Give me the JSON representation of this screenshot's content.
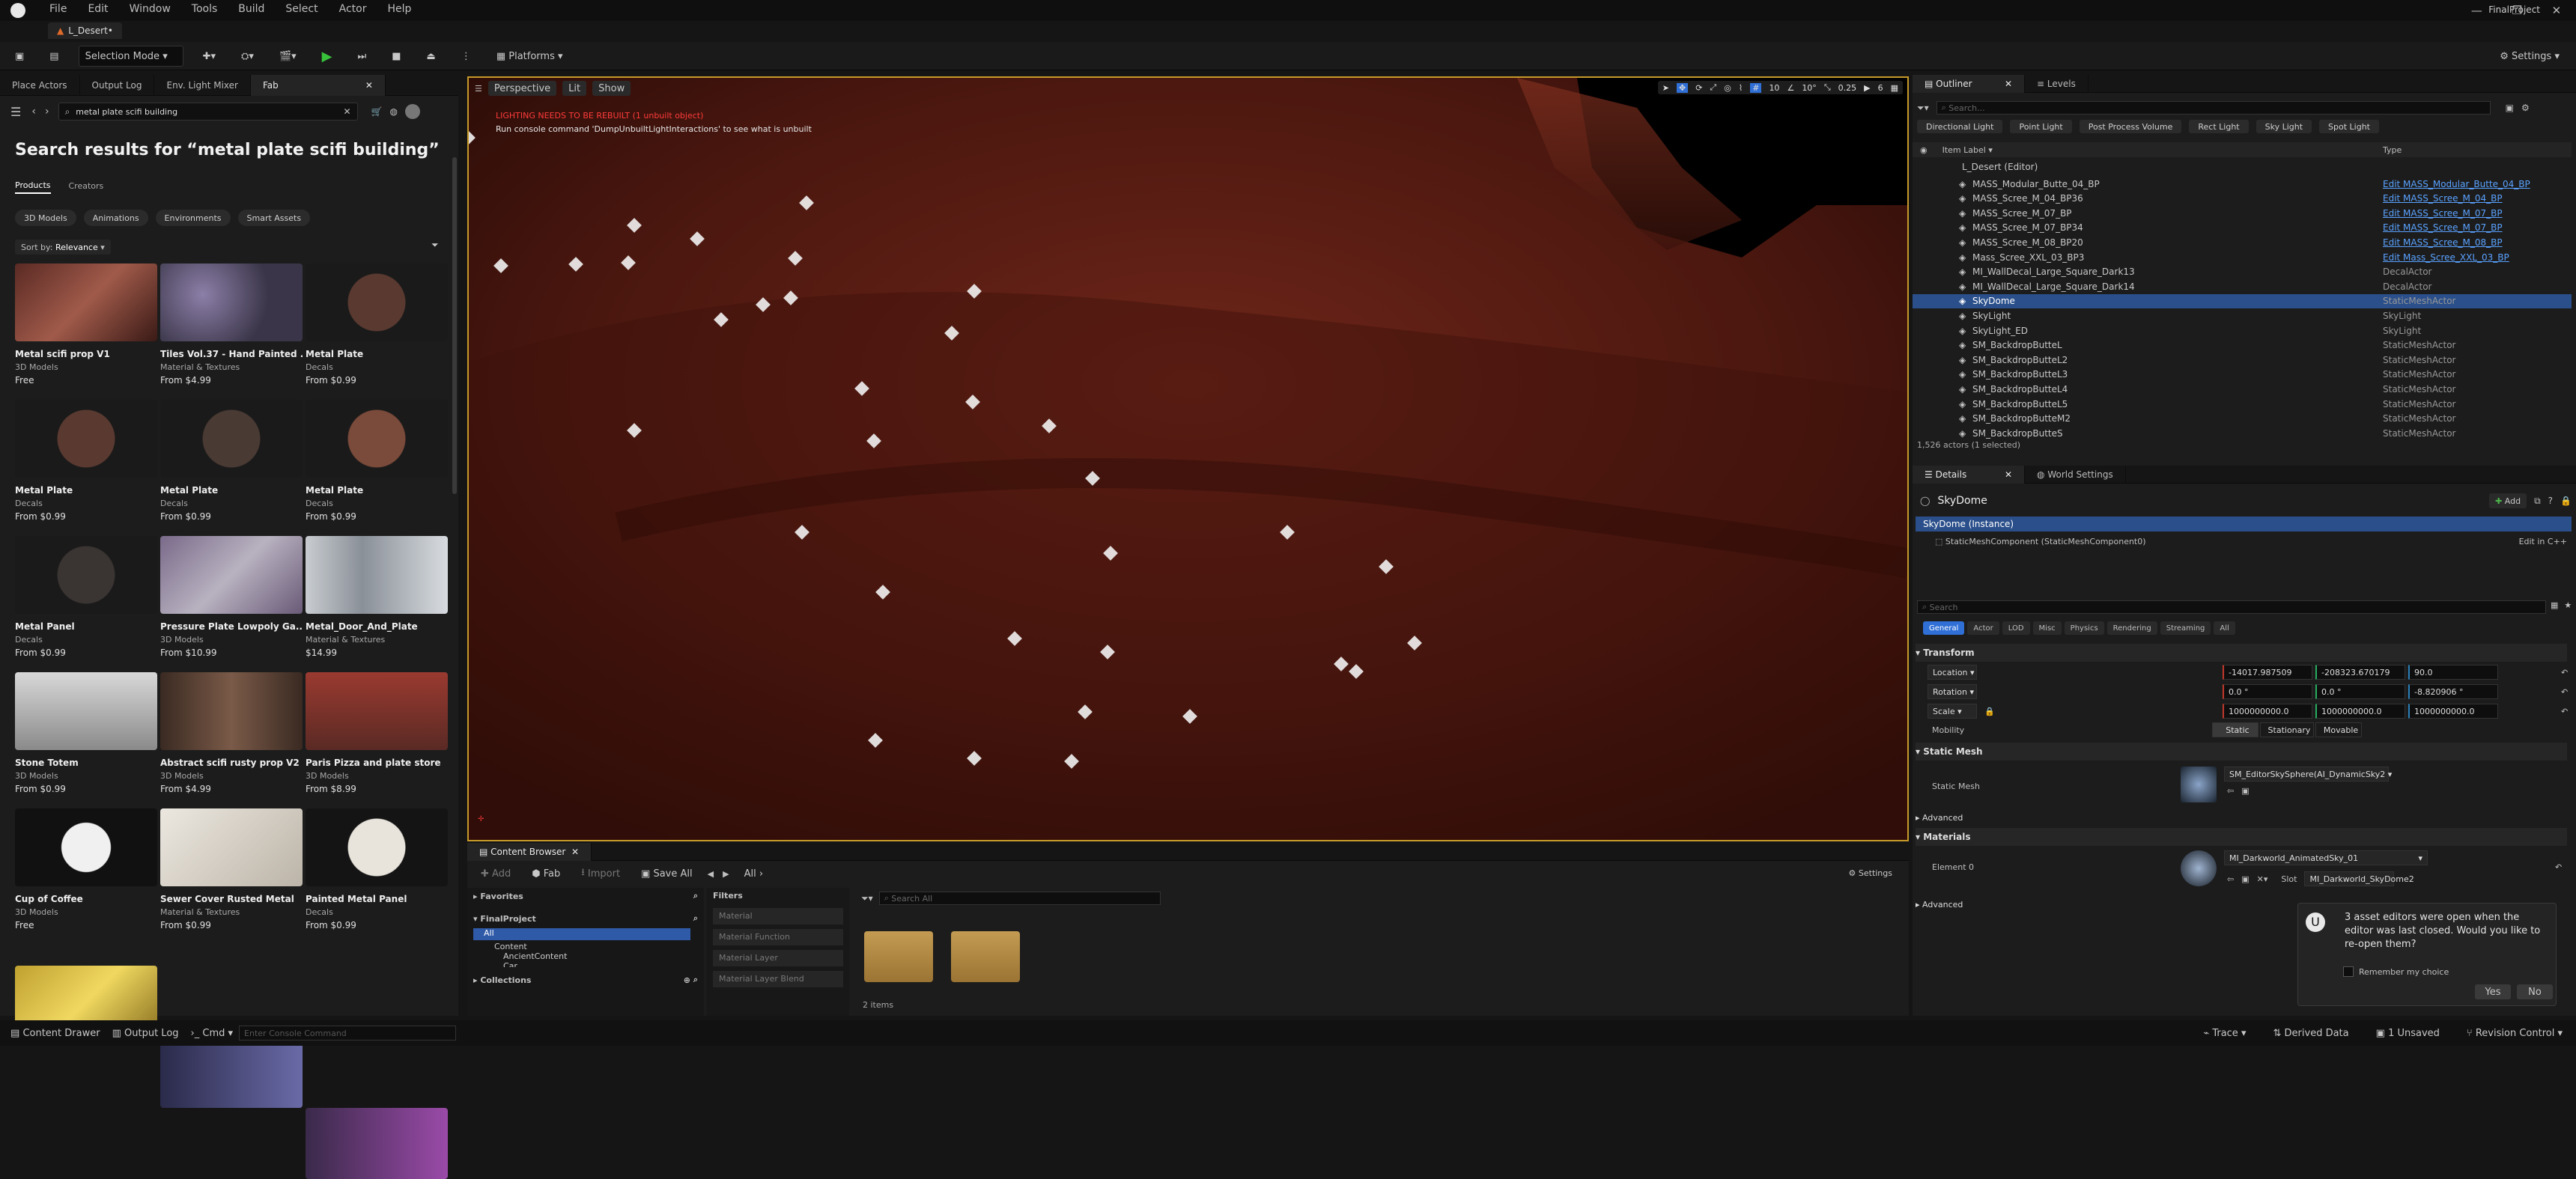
{
  "menu": [
    "File",
    "Edit",
    "Window",
    "Tools",
    "Build",
    "Select",
    "Actor",
    "Help"
  ],
  "level_name": "L_Desert•",
  "project_name": "FinalProject",
  "toolbar": {
    "selection_mode": "Selection Mode",
    "platforms": "Platforms",
    "settings": "Settings"
  },
  "left_tabs": [
    "Place Actors",
    "Output Log",
    "Env. Light Mixer",
    "Fab"
  ],
  "fab": {
    "search_query": "metal plate scifi building",
    "heading": "Search results for “metal plate scifi building”",
    "subtabs": [
      "Products",
      "Creators"
    ],
    "filters": [
      "3D Models",
      "Animations",
      "Environments",
      "Smart Assets"
    ],
    "sort_label": "Sort by:",
    "sort_value": "Relevance",
    "items": [
      {
        "title": "Metal scifi prop V1",
        "cat": "3D Models",
        "price": "Free"
      },
      {
        "title": "Tiles Vol.37 - Hand Painted ...",
        "cat": "Material & Textures",
        "price": "From $4.99"
      },
      {
        "title": "Metal Plate",
        "cat": "Decals",
        "price": "From $0.99"
      },
      {
        "title": "Metal Plate",
        "cat": "Decals",
        "price": "From $0.99"
      },
      {
        "title": "Metal Plate",
        "cat": "Decals",
        "price": "From $0.99"
      },
      {
        "title": "Metal Plate",
        "cat": "Decals",
        "price": "From $0.99"
      },
      {
        "title": "Metal Panel",
        "cat": "Decals",
        "price": "From $0.99"
      },
      {
        "title": "Pressure Plate Lowpoly Ga...",
        "cat": "3D Models",
        "price": "From $10.99"
      },
      {
        "title": "Metal_Door_And_Plate",
        "cat": "Material & Textures",
        "price": "$14.99"
      },
      {
        "title": "Stone Totem",
        "cat": "3D Models",
        "price": "From $0.99"
      },
      {
        "title": "Abstract scifi rusty prop V2",
        "cat": "3D Models",
        "price": "From $4.99"
      },
      {
        "title": "Paris Pizza and plate store",
        "cat": "3D Models",
        "price": "From $8.99"
      },
      {
        "title": "Cup of Coffee",
        "cat": "3D Models",
        "price": "Free"
      },
      {
        "title": "Sewer Cover Rusted Metal",
        "cat": "Material & Textures",
        "price": "From $0.99"
      },
      {
        "title": "Painted Metal Panel",
        "cat": "Decals",
        "price": "From $0.99"
      }
    ]
  },
  "viewport": {
    "perspective": "Perspective",
    "lit": "Lit",
    "show": "Show",
    "warning": "LIGHTING NEEDS TO BE REBUILT (1 unbuilt object)",
    "hint": "Run console command 'DumpUnbuiltLightInteractions' to see what is unbuilt",
    "grid": "10",
    "angle": "10°",
    "scale": "0.25",
    "cam": "6"
  },
  "content_browser": {
    "tab": "Content Browser",
    "add": "Add",
    "fab": "Fab",
    "import": "Import",
    "save_all": "Save All",
    "path": "All",
    "settings": "Settings",
    "favorites": "Favorites",
    "project": "FinalProject",
    "tree": [
      "All",
      "Content",
      "AncientContent",
      "Car"
    ],
    "collections": "Collections",
    "filters_label": "Filters",
    "filters": [
      "Material",
      "Material Function",
      "Material Layer",
      "Material Layer Blend"
    ],
    "search_placeholder": "Search All",
    "item_count": "2 items"
  },
  "outliner": {
    "tab": "Outliner",
    "levels_tab": "Levels",
    "search_placeholder": "Search...",
    "chips": [
      "Directional Light",
      "Point Light",
      "Post Process Volume",
      "Rect Light",
      "Sky Light",
      "Spot Light"
    ],
    "col_label": "Item Label",
    "col_type": "Type",
    "root": "L_Desert (Editor)",
    "rows": [
      {
        "n": "MASS_Modular_Butte_04_BP",
        "t": "Edit MASS_Modular_Butte_04_BP",
        "link": true
      },
      {
        "n": "MASS_Scree_M_04_BP36",
        "t": "Edit MASS_Scree_M_04_BP",
        "link": true
      },
      {
        "n": "MASS_Scree_M_07_BP",
        "t": "Edit MASS_Scree_M_07_BP",
        "link": true
      },
      {
        "n": "MASS_Scree_M_07_BP34",
        "t": "Edit MASS_Scree_M_07_BP",
        "link": true
      },
      {
        "n": "MASS_Scree_M_08_BP20",
        "t": "Edit MASS_Scree_M_08_BP",
        "link": true
      },
      {
        "n": "Mass_Scree_XXL_03_BP3",
        "t": "Edit Mass_Scree_XXL_03_BP",
        "link": true
      },
      {
        "n": "MI_WallDecal_Large_Square_Dark13",
        "t": "DecalActor",
        "link": false
      },
      {
        "n": "MI_WallDecal_Large_Square_Dark14",
        "t": "DecalActor",
        "link": false
      },
      {
        "n": "SkyDome",
        "t": "StaticMeshActor",
        "link": false
      },
      {
        "n": "SkyLight",
        "t": "SkyLight",
        "link": false
      },
      {
        "n": "SkyLight_ED",
        "t": "SkyLight",
        "link": false
      },
      {
        "n": "SM_BackdropButteL",
        "t": "StaticMeshActor",
        "link": false
      },
      {
        "n": "SM_BackdropButteL2",
        "t": "StaticMeshActor",
        "link": false
      },
      {
        "n": "SM_BackdropButteL3",
        "t": "StaticMeshActor",
        "link": false
      },
      {
        "n": "SM_BackdropButteL4",
        "t": "StaticMeshActor",
        "link": false
      },
      {
        "n": "SM_BackdropButteL5",
        "t": "StaticMeshActor",
        "link": false
      },
      {
        "n": "SM_BackdropButteM2",
        "t": "StaticMeshActor",
        "link": false
      },
      {
        "n": "SM_BackdropButteS",
        "t": "StaticMeshActor",
        "link": false
      }
    ],
    "footer": "1,526 actors (1 selected)"
  },
  "details": {
    "tab": "Details",
    "world_tab": "World Settings",
    "actor": "SkyDome",
    "add": "Add",
    "instance": "SkyDome (Instance)",
    "component": "StaticMeshComponent (StaticMeshComponent0)",
    "edit_cpp": "Edit in C++",
    "search_placeholder": "Search",
    "cats": [
      "General",
      "Actor",
      "LOD",
      "Misc",
      "Physics",
      "Rendering",
      "Streaming",
      "All"
    ],
    "transform": "Transform",
    "location": "Location",
    "rotation": "Rotation",
    "scale": "Scale",
    "loc": [
      "-14017.987509",
      "-208323.670179",
      "90.0"
    ],
    "rot": [
      "0.0 °",
      "0.0 °",
      "-8.820906 °"
    ],
    "scl": [
      "1000000000.0",
      "1000000000.0",
      "1000000000.0"
    ],
    "mobility": "Mobility",
    "mob_opts": [
      "Static",
      "Stationary",
      "Movable"
    ],
    "static_mesh_sec": "Static Mesh",
    "static_mesh_label": "Static Mesh",
    "mesh_value": "SM_EditorSkySphere(AI_DynamicSky2",
    "advanced": "Advanced",
    "materials": "Materials",
    "element0": "Element 0",
    "mat_value": "MI_Darkworld_AnimatedSky_01",
    "slot_label": "Slot",
    "slot_value": "MI_Darkworld_SkyDome2"
  },
  "popup": {
    "text": "3 asset editors were open when the editor was last closed. Would you like to re-open them?",
    "remember": "Remember my choice",
    "yes": "Yes",
    "no": "No"
  },
  "statusbar": {
    "content_drawer": "Content Drawer",
    "output_log": "Output Log",
    "cmd": "Cmd",
    "console_placeholder": "Enter Console Command",
    "trace": "Trace",
    "derived": "Derived Data",
    "unsaved": "1 Unsaved",
    "revision": "Revision Control"
  }
}
